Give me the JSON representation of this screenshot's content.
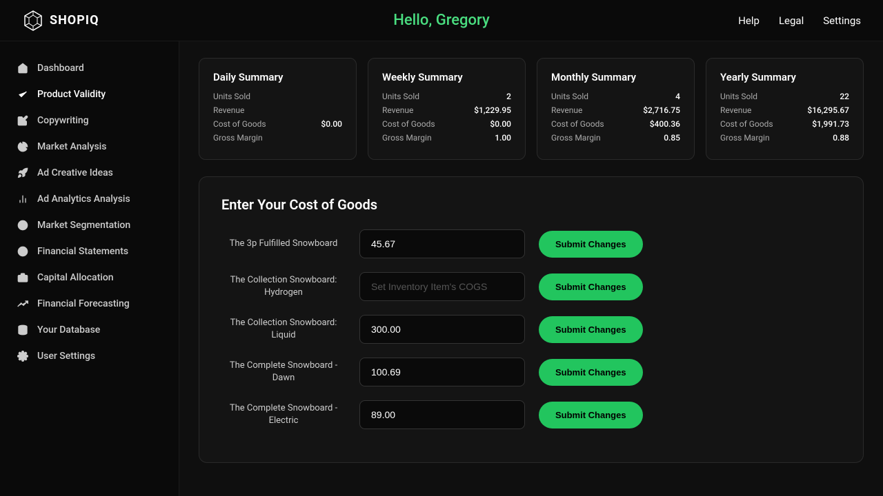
{
  "header": {
    "logo_text": "SHOPIQ",
    "greeting": "Hello, Gregory",
    "nav": [
      {
        "label": "Help",
        "id": "help"
      },
      {
        "label": "Legal",
        "id": "legal"
      },
      {
        "label": "Settings",
        "id": "settings"
      }
    ]
  },
  "sidebar": {
    "items": [
      {
        "id": "dashboard",
        "label": "Dashboard",
        "icon": "home"
      },
      {
        "id": "product-validity",
        "label": "Product Validity",
        "icon": "check"
      },
      {
        "id": "copywriting",
        "label": "Copywriting",
        "icon": "pen"
      },
      {
        "id": "market-analysis",
        "label": "Market Analysis",
        "icon": "chart-pie"
      },
      {
        "id": "ad-creative-ideas",
        "label": "Ad Creative Ideas",
        "icon": "rocket"
      },
      {
        "id": "ad-analytics",
        "label": "Ad Analytics Analysis",
        "icon": "bar-chart"
      },
      {
        "id": "market-segmentation",
        "label": "Market Segmentation",
        "icon": "target"
      },
      {
        "id": "financial-statements",
        "label": "Financial Statements",
        "icon": "dollar"
      },
      {
        "id": "capital-allocation",
        "label": "Capital Allocation",
        "icon": "briefcase"
      },
      {
        "id": "financial-forecasting",
        "label": "Financial Forecasting",
        "icon": "trending-up"
      },
      {
        "id": "your-database",
        "label": "Your Database",
        "icon": "database"
      },
      {
        "id": "user-settings",
        "label": "User Settings",
        "icon": "gear"
      }
    ]
  },
  "summary_cards": [
    {
      "title": "Daily Summary",
      "rows": [
        {
          "label": "Units Sold",
          "value": ""
        },
        {
          "label": "Revenue",
          "value": ""
        },
        {
          "label": "Cost of Goods",
          "value": "$0.00"
        },
        {
          "label": "Gross Margin",
          "value": ""
        }
      ]
    },
    {
      "title": "Weekly Summary",
      "rows": [
        {
          "label": "Units Sold",
          "value": "2"
        },
        {
          "label": "Revenue",
          "value": "$1,229.95"
        },
        {
          "label": "Cost of Goods",
          "value": "$0.00"
        },
        {
          "label": "Gross Margin",
          "value": "1.00"
        }
      ]
    },
    {
      "title": "Monthly Summary",
      "rows": [
        {
          "label": "Units Sold",
          "value": "4"
        },
        {
          "label": "Revenue",
          "value": "$2,716.75"
        },
        {
          "label": "Cost of Goods",
          "value": "$400.36"
        },
        {
          "label": "Gross Margin",
          "value": "0.85"
        }
      ]
    },
    {
      "title": "Yearly Summary",
      "rows": [
        {
          "label": "Units Sold",
          "value": "22"
        },
        {
          "label": "Revenue",
          "value": "$16,295.67"
        },
        {
          "label": "Cost of Goods",
          "value": "$1,991.73"
        },
        {
          "label": "Gross Margin",
          "value": "0.88"
        }
      ]
    }
  ],
  "cog_section": {
    "title": "Enter Your Cost of Goods",
    "products": [
      {
        "id": "3p-fulfilled",
        "name": "The 3p Fulfilled Snowboard",
        "value": "45.67",
        "placeholder": ""
      },
      {
        "id": "collection-hydrogen",
        "name": "The Collection Snowboard:\nHydrogen",
        "value": "",
        "placeholder": "Set Inventory Item's COGS"
      },
      {
        "id": "collection-liquid",
        "name": "The Collection Snowboard:\nLiquid",
        "value": "300.00",
        "placeholder": ""
      },
      {
        "id": "complete-dawn",
        "name": "The Complete Snowboard -\nDawn",
        "value": "100.69",
        "placeholder": ""
      },
      {
        "id": "complete-electric",
        "name": "The Complete Snowboard -\nElectric",
        "value": "89.00",
        "placeholder": ""
      }
    ],
    "submit_label": "Submit Changes"
  }
}
